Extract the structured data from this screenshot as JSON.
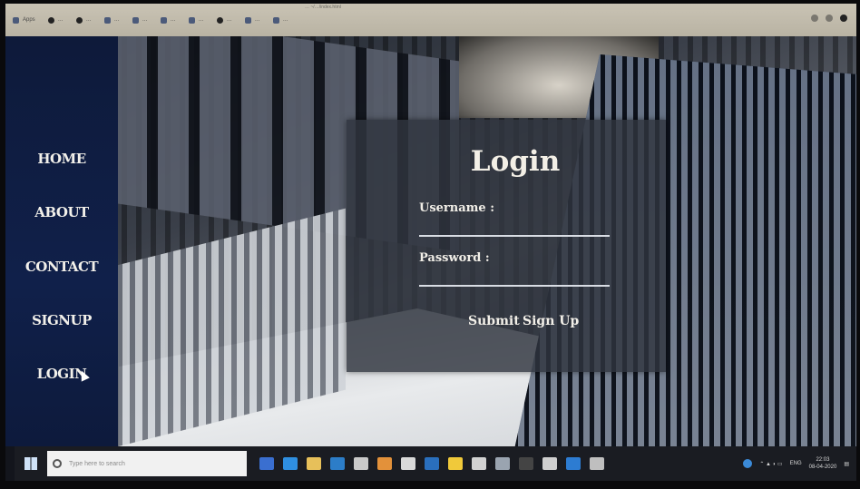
{
  "browser": {
    "url_fragment": "… ~/…/index.html",
    "bookmarks": [
      "Apps",
      "…",
      "…",
      "…",
      "…",
      "…",
      "…",
      "…",
      "…",
      "…"
    ]
  },
  "nav": {
    "items": [
      {
        "label": "HOME"
      },
      {
        "label": "ABOUT"
      },
      {
        "label": "CONTACT"
      },
      {
        "label": "SIGNUP"
      },
      {
        "label": "LOGIN"
      }
    ]
  },
  "login": {
    "title": "Login",
    "username_label": "Username :",
    "username_value": "",
    "password_label": "Password :",
    "password_value": "",
    "submit_label": "Submit",
    "signup_label": "Sign Up"
  },
  "taskbar": {
    "search_placeholder": "Type here to search",
    "tray_language": "ENG",
    "clock_time": "22:03",
    "clock_date": "08-04-2020"
  },
  "colors": {
    "sidebar": "#10204a",
    "panel": "#30343e",
    "text": "#f2efe8"
  }
}
